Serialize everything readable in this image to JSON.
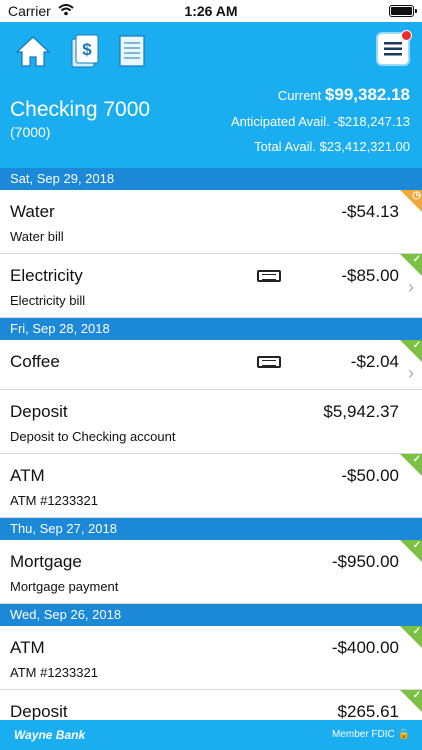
{
  "status": {
    "carrier": "Carrier",
    "time": "1:26 AM"
  },
  "header": {
    "account_name": "Checking 7000",
    "account_number": "(7000)",
    "current_label": "Current",
    "current_value": "$99,382.18",
    "anticipated": "Anticipated Avail. -$218,247.13",
    "total": "Total Avail. $23,412,321.00",
    "nav_icons": [
      "home-icon",
      "money-icon",
      "statement-icon",
      "menu-icon"
    ]
  },
  "groups": [
    {
      "date": "Sat, Sep 29, 2018",
      "txns": [
        {
          "title": "Water",
          "sub": "Water bill",
          "amount": "-$54.13",
          "status": "pending"
        },
        {
          "title": "Electricity",
          "sub": "Electricity bill",
          "amount": "-$85.00",
          "status": "cleared",
          "note": true,
          "chevron": true
        }
      ]
    },
    {
      "date": "Fri, Sep 28, 2018",
      "txns": [
        {
          "title": "Coffee",
          "sub": "",
          "amount": "-$2.04",
          "status": "cleared",
          "note": true,
          "chevron": true
        },
        {
          "title": "Deposit",
          "sub": "Deposit to Checking account",
          "amount": "$5,942.37",
          "status": "none"
        },
        {
          "title": "ATM",
          "sub": "ATM #1233321",
          "amount": "-$50.00",
          "status": "cleared"
        }
      ]
    },
    {
      "date": "Thu, Sep 27, 2018",
      "txns": [
        {
          "title": "Mortgage",
          "sub": "Mortgage payment",
          "amount": "-$950.00",
          "status": "cleared"
        }
      ]
    },
    {
      "date": "Wed, Sep 26, 2018",
      "txns": [
        {
          "title": "ATM",
          "sub": "ATM #1233321",
          "amount": "-$400.00",
          "status": "cleared"
        },
        {
          "title": "Deposit",
          "sub": "",
          "amount": "$265.61",
          "status": "cleared"
        }
      ]
    }
  ],
  "footer": {
    "brand": "Wayne Bank",
    "fdic": "Member FDIC"
  },
  "colors": {
    "header_bg": "#1aaef0",
    "date_bg": "#1b88d8",
    "cleared": "#7bc043",
    "pending": "#f0a83a"
  }
}
